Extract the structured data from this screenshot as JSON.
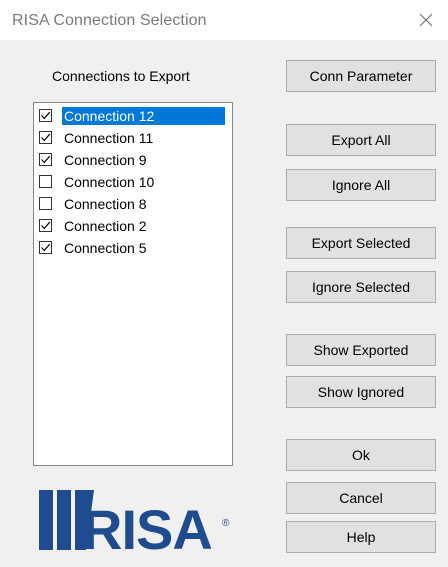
{
  "window": {
    "title": "RISA Connection Selection",
    "close_glyph": "×"
  },
  "list": {
    "heading": "Connections to Export",
    "items": [
      {
        "label": "Connection 12",
        "checked": true,
        "selected": true
      },
      {
        "label": "Connection 11",
        "checked": true,
        "selected": false
      },
      {
        "label": "Connection 9",
        "checked": true,
        "selected": false
      },
      {
        "label": "Connection 10",
        "checked": false,
        "selected": false
      },
      {
        "label": "Connection 8",
        "checked": false,
        "selected": false
      },
      {
        "label": "Connection 2",
        "checked": true,
        "selected": false
      },
      {
        "label": "Connection 5",
        "checked": true,
        "selected": false
      }
    ]
  },
  "buttons": {
    "conn_parameter": "Conn Parameter",
    "export_all": "Export All",
    "ignore_all": "Ignore All",
    "export_selected": "Export Selected",
    "ignore_selected": "Ignore Selected",
    "show_exported": "Show Exported",
    "show_ignored": "Show Ignored",
    "ok": "Ok",
    "cancel": "Cancel",
    "help": "Help"
  },
  "logo": {
    "text": "RISA",
    "registered": "®"
  },
  "colors": {
    "selection": "#0078d7",
    "logo_blue": "#1f4c8f",
    "title_text": "#7a7a7a"
  }
}
